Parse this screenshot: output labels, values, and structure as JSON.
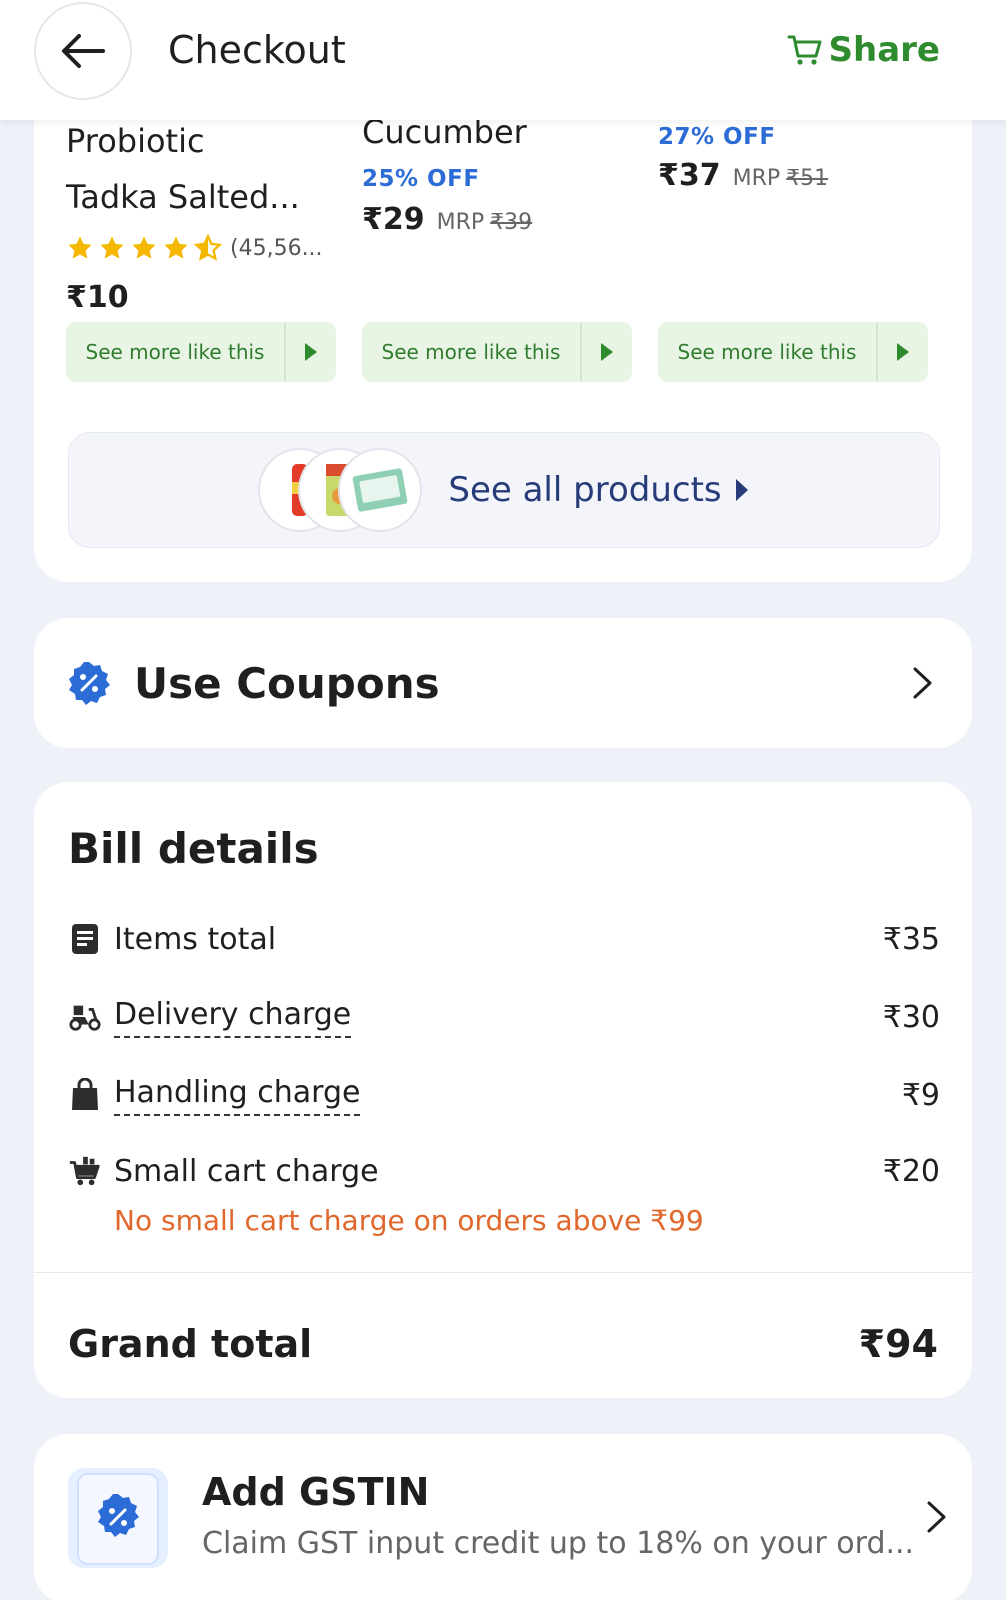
{
  "header": {
    "title": "Checkout",
    "share_label": "Share"
  },
  "products": [
    {
      "name_line1": "Probiotic",
      "name_line2": "Tadka Salted...",
      "rating_count": "(45,56...",
      "price": "₹10",
      "see_more": "See more like this"
    },
    {
      "name_line1": "Cucumber",
      "discount": "25% OFF",
      "price": "₹29",
      "mrp_label": "MRP",
      "mrp": "₹39",
      "see_more": "See more like this"
    },
    {
      "discount": "27% OFF",
      "price": "₹37",
      "mrp_label": "MRP",
      "mrp": "₹51",
      "see_more": "See more like this"
    }
  ],
  "see_all": {
    "label": "See all products"
  },
  "coupons": {
    "label": "Use Coupons"
  },
  "bill": {
    "title": "Bill details",
    "rows": [
      {
        "label": "Items total",
        "value": "₹35"
      },
      {
        "label": "Delivery charge",
        "value": "₹30"
      },
      {
        "label": "Handling charge",
        "value": "₹9"
      },
      {
        "label": "Small cart charge",
        "value": "₹20"
      }
    ],
    "small_cart_note": "No small cart charge on orders above ₹99",
    "grand_total_label": "Grand total",
    "grand_total_value": "₹94"
  },
  "gstin": {
    "title": "Add GSTIN",
    "subtitle": "Claim GST input credit up to 18% on your ord..."
  },
  "colors": {
    "brand_green": "#2e8b2e",
    "discount_blue": "#2c6cd6",
    "note_orange": "#e0682c",
    "star_yellow": "#f5b800"
  }
}
